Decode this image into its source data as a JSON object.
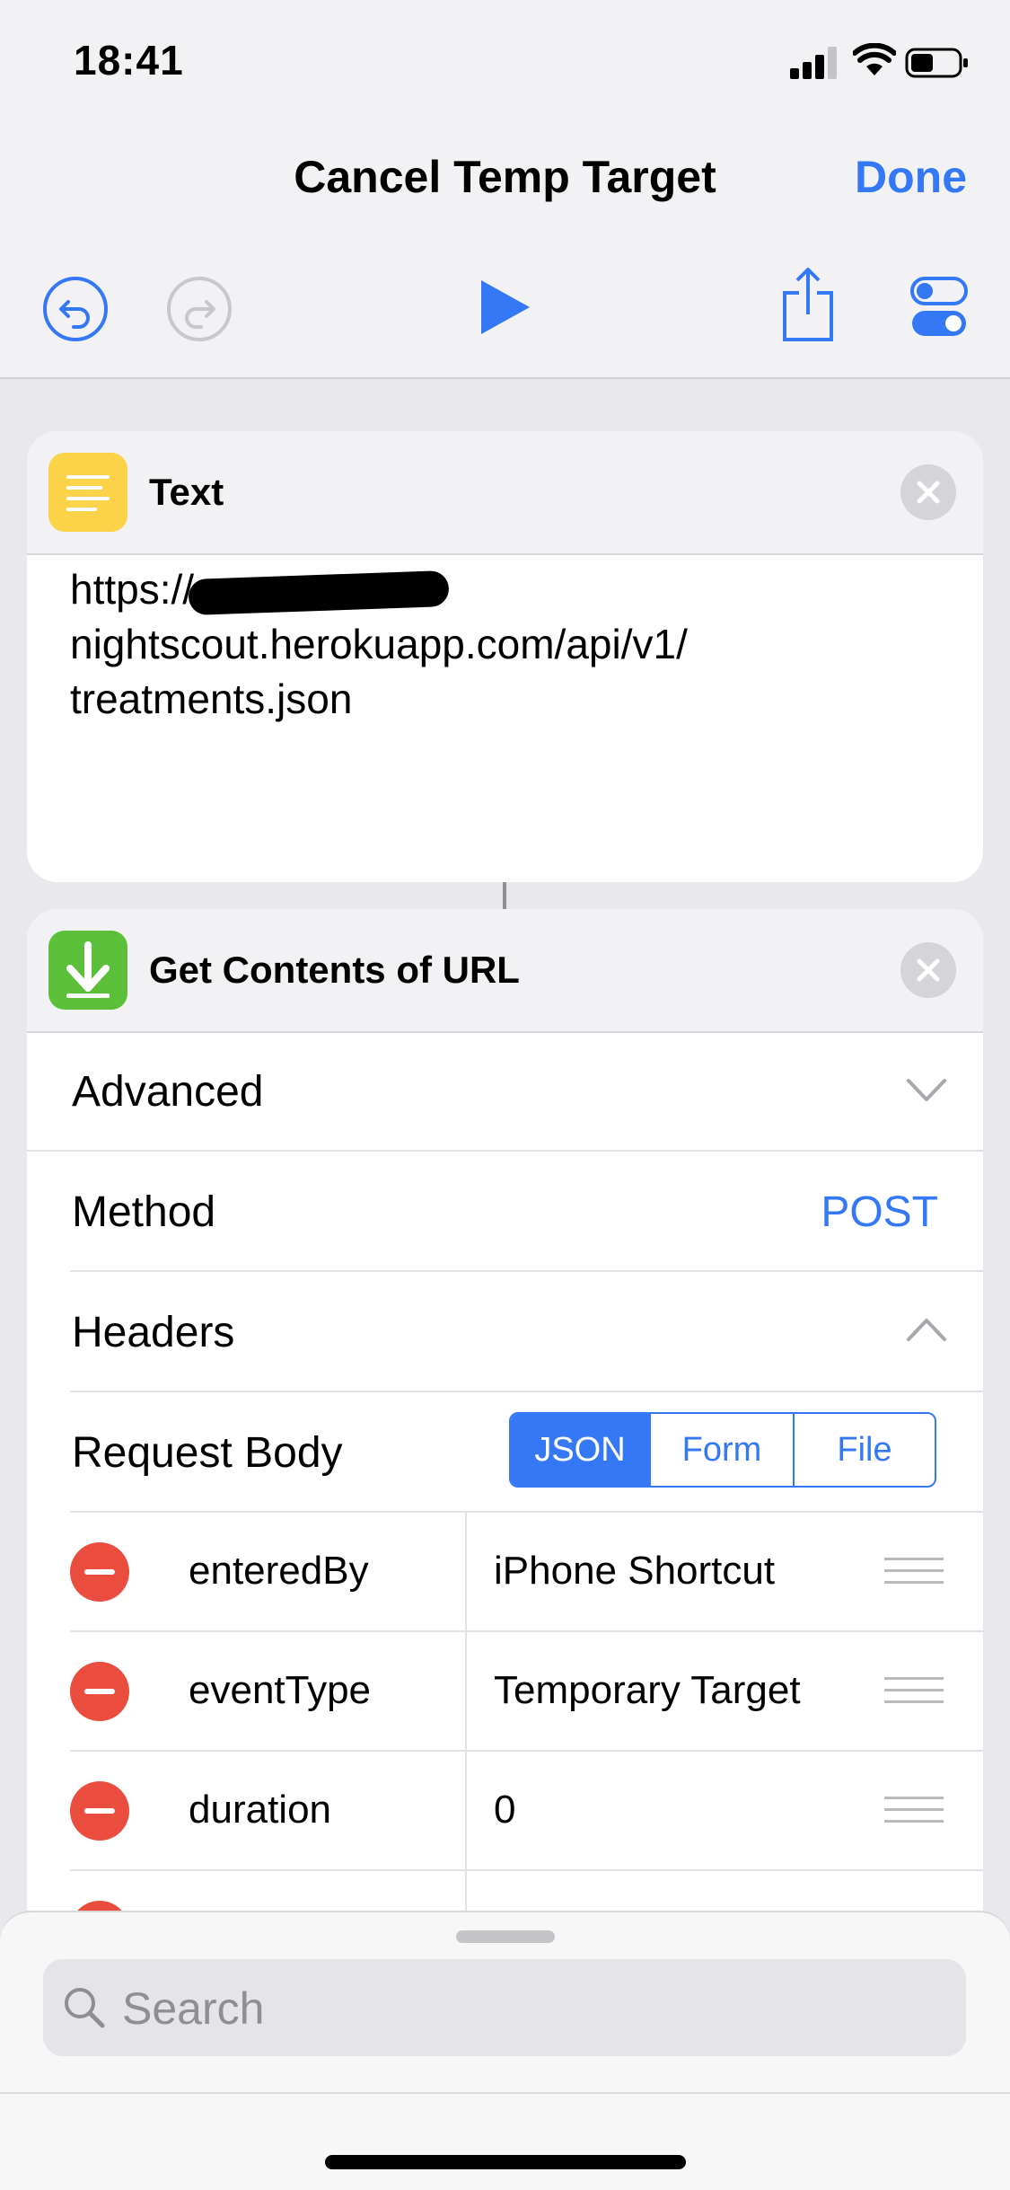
{
  "status_bar": {
    "time": "18:41"
  },
  "nav": {
    "title": "Cancel Temp Target",
    "done_label": "Done"
  },
  "toolbar": {
    "undo_icon": "undo-icon",
    "redo_icon": "redo-icon",
    "play_icon": "play-icon",
    "share_icon": "share-icon",
    "settings_icon": "toggles-icon"
  },
  "text_action": {
    "title": "Text",
    "url_prefix": "https://",
    "url_line2": "nightscout.herokuapp.com/api/v1/",
    "url_line3": "treatments.json"
  },
  "url_action": {
    "title": "Get Contents of URL",
    "advanced_label": "Advanced",
    "method_label": "Method",
    "method_value": "POST",
    "headers_label": "Headers",
    "request_body_label": "Request Body",
    "body_types": [
      "JSON",
      "Form",
      "File"
    ],
    "selected_body_type": "JSON",
    "fields": [
      {
        "key": "enteredBy",
        "value": "iPhone Shortcut"
      },
      {
        "key": "eventType",
        "value": "Temporary Target"
      },
      {
        "key": "duration",
        "value": "0"
      }
    ]
  },
  "search": {
    "placeholder": "Search"
  },
  "colors": {
    "accent": "#3478f6",
    "text_icon": "#fcd348",
    "url_icon": "#5bbf3a",
    "delete": "#ea4c3e"
  }
}
